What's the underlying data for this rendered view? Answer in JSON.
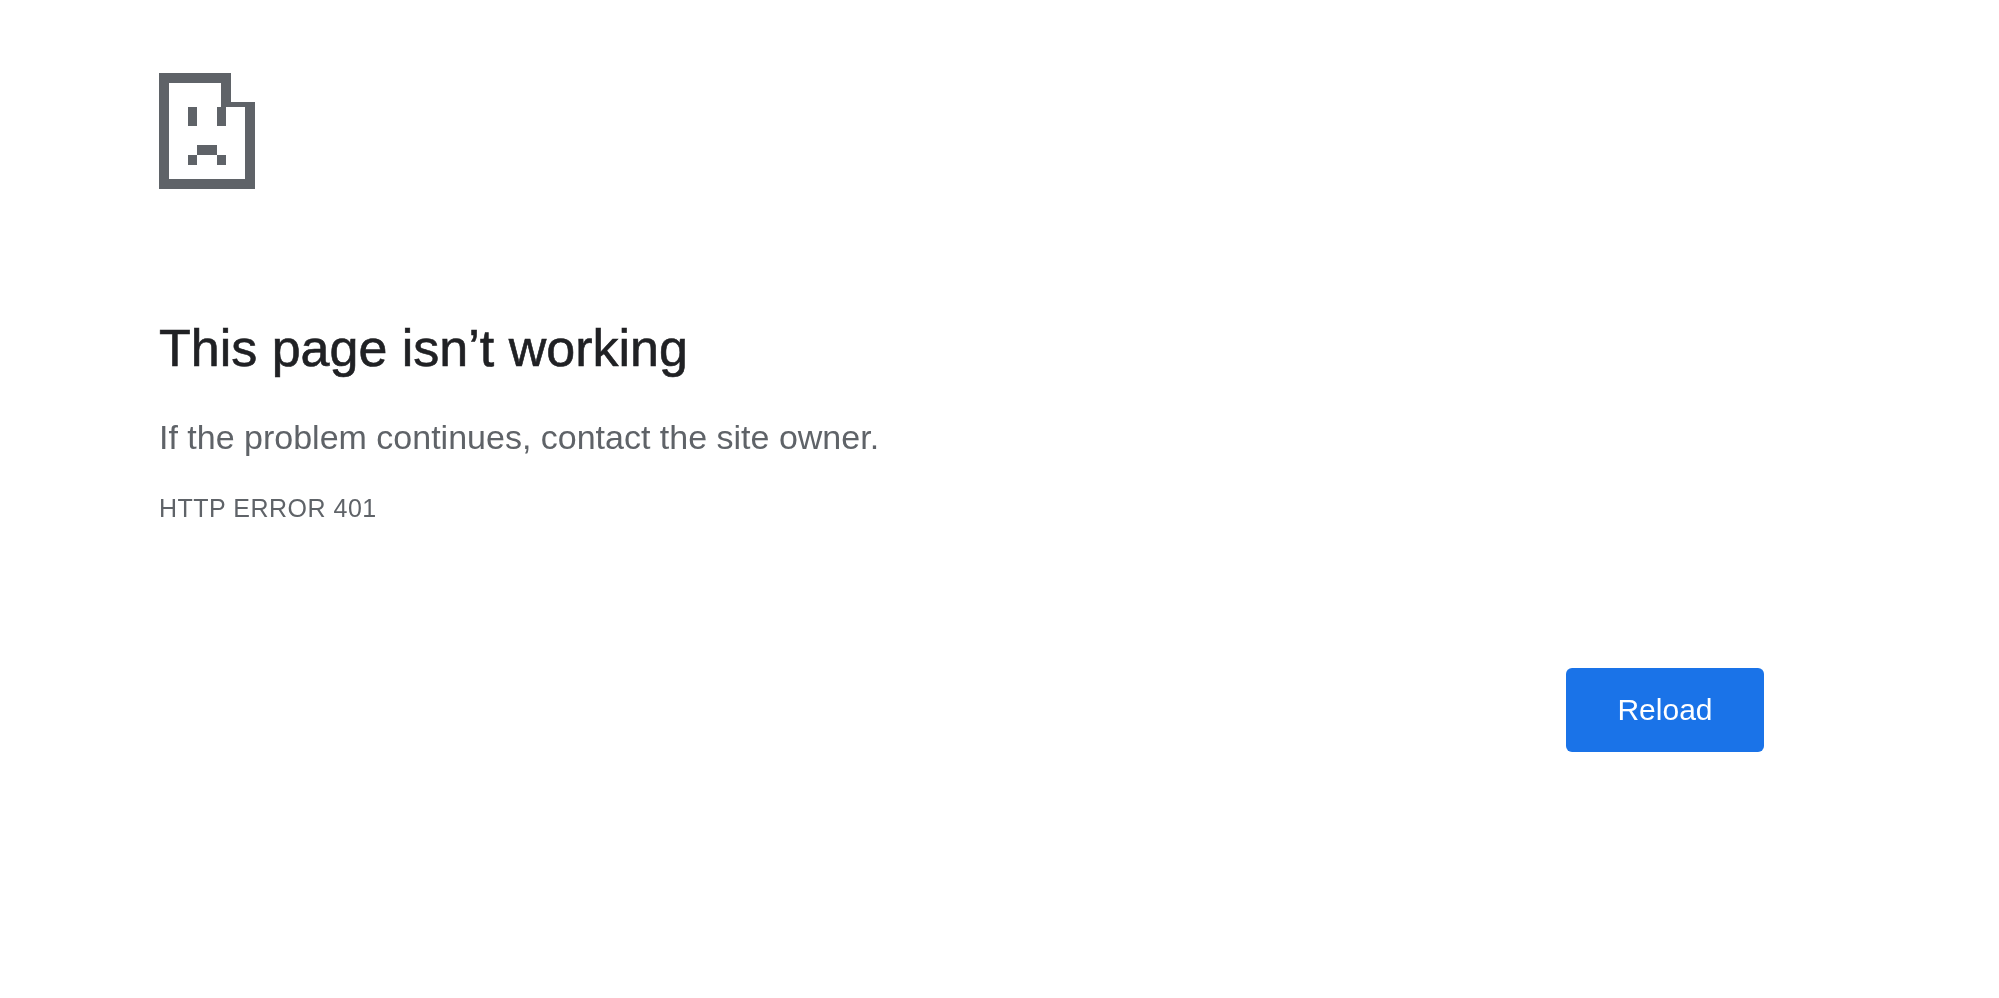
{
  "heading": "This page isn’t working",
  "message": "If the problem continues, contact the site owner.",
  "error_code": "HTTP ERROR 401",
  "buttons": [
    "Reload"
  ]
}
